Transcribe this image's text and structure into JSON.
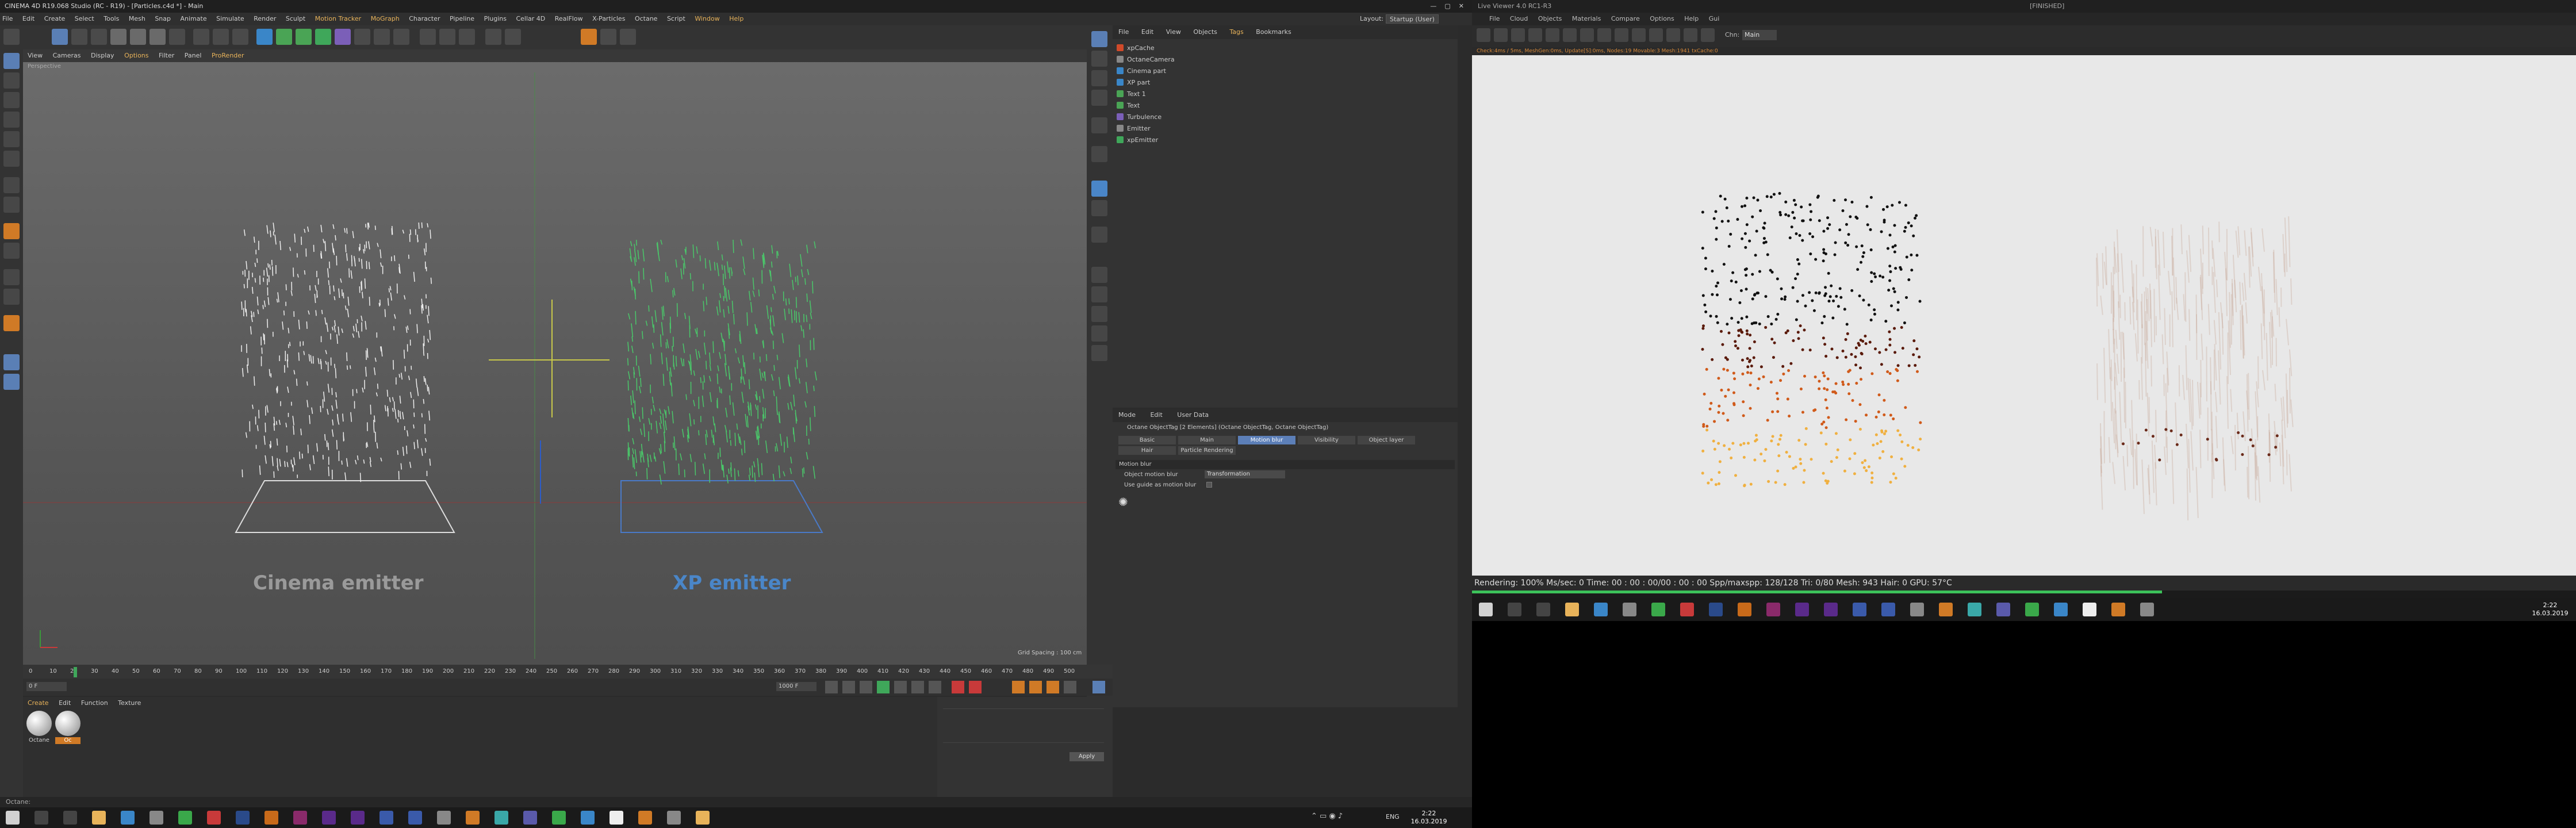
{
  "c4d": {
    "title": "CINEMA 4D R19.068 Studio (RC - R19) - [Particles.c4d *] - Main",
    "menu": [
      "File",
      "Edit",
      "Create",
      "Select",
      "Tools",
      "Mesh",
      "Snap",
      "Animate",
      "Simulate",
      "Render",
      "Sculpt",
      "Motion Tracker",
      "MoGraph",
      "Character",
      "Pipeline",
      "Plugins",
      "Cellar 4D",
      "RealFlow",
      "X-Particles",
      "Octane",
      "Script",
      "Window",
      "Help"
    ],
    "viewport_menu": [
      "View",
      "Cameras",
      "Display",
      "Options",
      "Filter",
      "Panel",
      "ProRender"
    ],
    "viewport_name": "Perspective",
    "label_left": "Cinema emitter",
    "label_right": "XP emitter",
    "grid_spacing": "Grid Spacing : 100 cm",
    "layout_label": "Layout:",
    "layout_value": "Startup (User)",
    "obj_tabs": [
      "File",
      "Edit",
      "View",
      "Objects",
      "Tags",
      "Bookmarks"
    ],
    "objects": [
      "xpCache",
      "OctaneCamera",
      "Cinema part",
      "XP part",
      "Text 1",
      "Text",
      "Turbulence",
      "Emitter",
      "xpEmitter"
    ],
    "attr_tabs": [
      "Mode",
      "Edit",
      "User Data"
    ],
    "attr_title": "Octane ObjectTag [2 Elements] (Octane ObjectTag, Octane ObjectTag)",
    "attr_buttons": [
      "Basic",
      "Main",
      "Motion blur",
      "Visibility",
      "Object layer",
      "Hair",
      "Particle Rendering"
    ],
    "attr_section": "Motion blur",
    "attr_field1": "Object motion blur",
    "attr_field1_value": "Transformation",
    "attr_field2": "Use guide as motion blur",
    "timeline_ticks": [
      "0",
      "10",
      "20",
      "30",
      "40",
      "50",
      "60",
      "70",
      "80",
      "90",
      "100",
      "110",
      "120",
      "130",
      "140",
      "150",
      "160",
      "170",
      "180",
      "190",
      "200",
      "210",
      "220",
      "230",
      "240",
      "250",
      "260",
      "270",
      "280",
      "290",
      "300",
      "310",
      "320",
      "330",
      "340",
      "350",
      "360",
      "370",
      "380",
      "390",
      "400",
      "410",
      "420",
      "430",
      "440",
      "450",
      "460",
      "470",
      "480",
      "490",
      "500"
    ],
    "frame_start": "0 F",
    "frame_end": "1000 F",
    "mat_menu": [
      "Create",
      "Edit",
      "Function",
      "Texture"
    ],
    "materials": [
      "Octane",
      "Oc"
    ],
    "apply": "Apply",
    "status": "Octane:"
  },
  "octane": {
    "title": "Live Viewer 4.0 RC1-R3",
    "finished": "[FINISHED]",
    "menu": [
      "File",
      "Cloud",
      "Objects",
      "Materials",
      "Compare",
      "Options",
      "Help",
      "Gui"
    ],
    "channel": "Main",
    "check": "Check:4ms / 5ms, MeshGen:0ms, Update[S]:0ms, Nodes:19 Movable:3 Mesh:1941 txCache:0",
    "status": "Rendering: 100%  Ms/sec: 0    Time: 00 : 00 : 00/00 : 00 : 00   Spp/maxspp: 128/128    Tri: 0/80   Mesh: 943    Hair: 0       GPU:",
    "temp": "57°C"
  },
  "taskbar": {
    "lang": "ENG",
    "time": "2:22",
    "date": "16.03.2019"
  }
}
